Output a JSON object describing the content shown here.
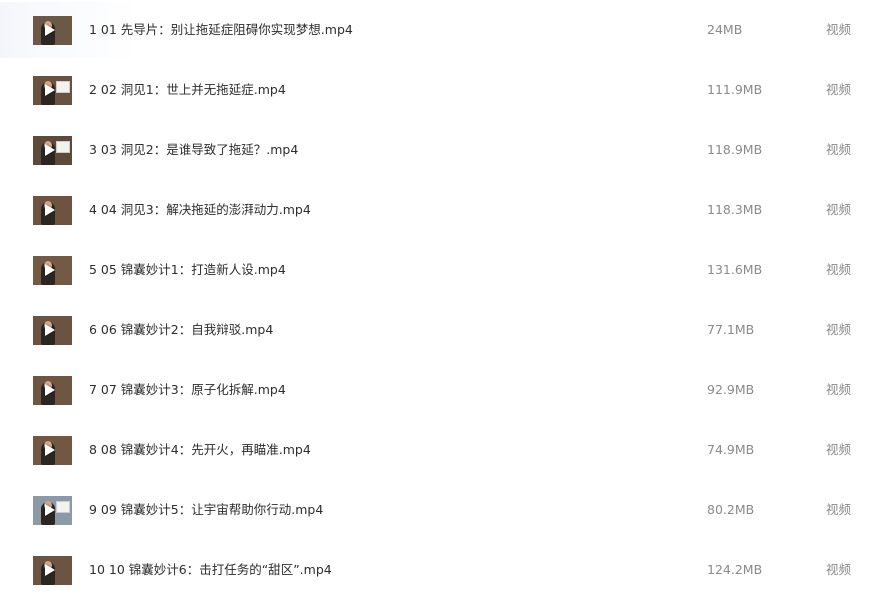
{
  "files": [
    {
      "name": "1 01 先导片：别让拖延症阻碍你实现梦想.mp4",
      "size": "24MB",
      "type": "视频",
      "thumb": {
        "bg": "#6b5846",
        "board": false
      }
    },
    {
      "name": "2 02 洞见1：世上并无拖延症.mp4",
      "size": "111.9MB",
      "type": "视频",
      "thumb": {
        "bg": "#6a5240",
        "board": true
      }
    },
    {
      "name": "3 03 洞见2：是谁导致了拖延？.mp4",
      "size": "118.9MB",
      "type": "视频",
      "thumb": {
        "bg": "#5d4a3b",
        "board": true
      }
    },
    {
      "name": "4 04 洞见3：解决拖延的澎湃动力.mp4",
      "size": "118.3MB",
      "type": "视频",
      "thumb": {
        "bg": "#6e5440",
        "board": false
      }
    },
    {
      "name": "5 05 锦囊妙计1：打造新人设.mp4",
      "size": "131.6MB",
      "type": "视频",
      "thumb": {
        "bg": "#735a44",
        "board": false
      }
    },
    {
      "name": "6 06 锦囊妙计2：自我辩驳.mp4",
      "size": "77.1MB",
      "type": "视频",
      "thumb": {
        "bg": "#6b5241",
        "board": false
      }
    },
    {
      "name": "7 07 锦囊妙计3：原子化拆解.mp4",
      "size": "92.9MB",
      "type": "视频",
      "thumb": {
        "bg": "#6f5643",
        "board": false
      }
    },
    {
      "name": "8 08 锦囊妙计4：先开火，再瞄准.mp4",
      "size": "74.9MB",
      "type": "视频",
      "thumb": {
        "bg": "#725843",
        "board": false
      }
    },
    {
      "name": "9 09 锦囊妙计5：让宇宙帮助你行动.mp4",
      "size": "80.2MB",
      "type": "视频",
      "thumb": {
        "bg": "#8c9aa6",
        "board": true
      }
    },
    {
      "name": "10 10 锦囊妙计6：击打任务的“甜区”.mp4",
      "size": "124.2MB",
      "type": "视频",
      "thumb": {
        "bg": "#6c5342",
        "board": false
      }
    }
  ]
}
